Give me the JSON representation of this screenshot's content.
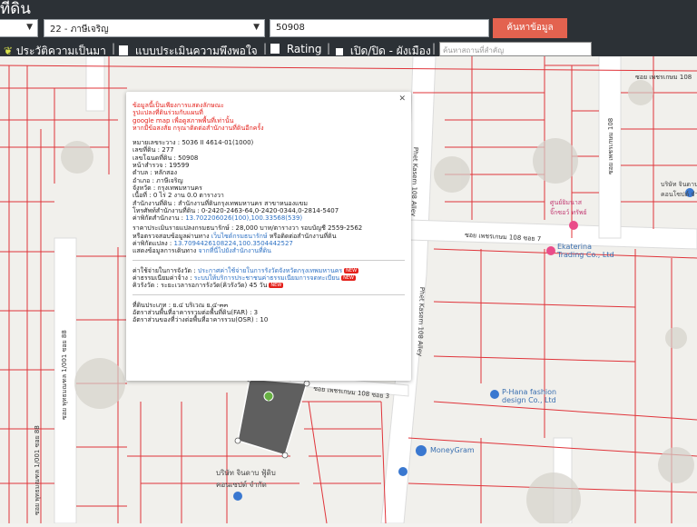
{
  "header": {
    "title": "ที่ดิน",
    "province_select": "22 - ภาษีเจริญ",
    "parcel_input": "50908",
    "search_button": "ค้นหาข้อมูล",
    "place_placeholder": "ค้นหาสถานที่สำคัญ"
  },
  "toolbar": {
    "history": "ประวัติความเป็นมา",
    "survey": "แบบประเมินความพึงพอใจ",
    "rating": "Rating",
    "toggle": "เปิด/ปิด - ผังเมือง"
  },
  "popup": {
    "notice": [
      "ข้อมูลนี้เป็นเพียงการแสดงลักษณะ",
      "รูปแปลงที่ดินร่วมกับแผนที่",
      "google map เพื่อดูสภาพพื้นที่เท่านั้น",
      "หากมีข้อสงสัย กรุณาติดต่อสำนักงานที่ดินอีกครั้ง"
    ],
    "fields": [
      {
        "label": "หมายเลขระวาง : ",
        "value": "5036 II 4614-01(1000)"
      },
      {
        "label": "เลขที่ดิน : ",
        "value": "277"
      },
      {
        "label": "เลขโฉนดที่ดิน : ",
        "value": "50908"
      },
      {
        "label": "หน้าสำรวจ : ",
        "value": "19599"
      },
      {
        "label": "ตำบล : ",
        "value": "หลักสอง"
      },
      {
        "label": "อำเภอ : ",
        "value": "ภาษีเจริญ"
      },
      {
        "label": "จังหวัด : ",
        "value": "กรุงเทพมหานคร"
      },
      {
        "label": "เนื้อที่ : ",
        "value": "0 ไร่ 2 งาน 0.0 ตารางวา"
      },
      {
        "label": "สำนักงานที่ดิน : ",
        "value": "สำนักงานที่ดินกรุงเทพมหานคร สาขาหนองแขม"
      },
      {
        "label": "โทรศัพท์สำนักงานที่ดิน : ",
        "value": "0-2420-2463-64,0-2420-0344,0-2814-5407"
      },
      {
        "label": "ค่าพิกัดสำนักงาน : ",
        "value": "13.702206026(100),100.33568(539)",
        "link": true
      }
    ],
    "price": [
      {
        "label": "ราคาประเมินรายแปลงกรมธนารักษ์ : ",
        "value": "28,000 บาท/ตารางวา รอบบัญชี 2559-2562"
      },
      {
        "label": "หรือตรวจสอบข้อมูลผ่านทาง ",
        "value": "เว็บไซต์กรมธนารักษ์",
        "suffix": " หรือติดต่อสำนักงานที่ดิน",
        "link": true
      },
      {
        "label": "ค่าพิกัดแปลง : ",
        "value": "13.7094426108224,100.3504442527",
        "link": true
      },
      {
        "label": "แสดงข้อมูลการเดินทาง ",
        "value": "จากที่นี่ไปยังสำนักงานที่ดิน",
        "link": true
      }
    ],
    "links": [
      {
        "label": "ค่าใช้จ่ายในการจังวัด : ",
        "value": "ประกาศค่าใช้จ่ายในการรังวัดจังหวัดกรุงเทพมหานคร",
        "badge": "NEW"
      },
      {
        "label": "ค่าธรรมเนียมค่าจ้าง : ",
        "value": "ระบบให้บริการประชาชนค่าธรรมเนียมการจดทะเบียน",
        "badge": "NEW"
      },
      {
        "label": "คิวรังวัด : ",
        "value": "ระยะเวลารอการรังวัด(คิวรังวัด) 45 วัน",
        "badge": "NEW"
      }
    ],
    "zoning": [
      {
        "label": "ที่ดินประเภท : ",
        "value": "ย.๔ บริเวณ ย.๔-๓๓"
      },
      {
        "label": "อัตราส่วนพื้นที่อาคารรวมต่อพื้นที่ดิน(FAR) : ",
        "value": "3"
      },
      {
        "label": "อัตราส่วนของที่ว่างต่อพื้นที่อาคารรวม(OSR) : ",
        "value": "10"
      }
    ]
  },
  "map": {
    "labels": [
      {
        "text": "Ekaterina\nTrading Co., Ltd",
        "kind": "business"
      },
      {
        "text": "P-Hana fashion\ndesign Co., Ltd",
        "kind": "business"
      },
      {
        "text": "MoneyGram",
        "kind": "business"
      },
      {
        "text": "บริษัท จินดาบ ฟู้ดิบ\nคอนเซปต์ จำกัด",
        "kind": "business"
      },
      {
        "text": "บริษัท จินดานา ฟู้ดิบ\nคอนโซปต์ จำกัด",
        "kind": "business"
      },
      {
        "text": "ศูนย์ยิมนาส\nจิ๊กซอว์ ทรัพย์",
        "kind": "business"
      }
    ],
    "roads": [
      "ซอย เพชรเกษม 108",
      "ซอย เพชรเกษม 108",
      "ซอย เพชรเกษม 108 ซอย 7",
      "ซอย เพชรเกษม 108 ซอย 3",
      "Phet Kasem 108 Alley",
      "Phet Kasem 108 Alley",
      "ซอย พุทธมณฑล 1/001 ซอย 88",
      "ซอย พุทธมณฑล 1/001 ซอย 88"
    ],
    "colors": {
      "parcel": "#e0343a",
      "parcel_fill": "#5f5f5f",
      "road": "#ffffff",
      "map_bg": "#f1f0ec"
    }
  }
}
